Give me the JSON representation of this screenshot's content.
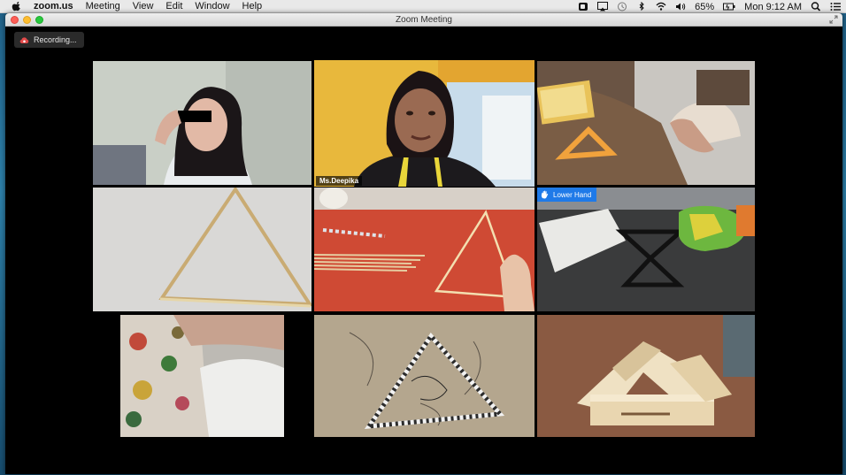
{
  "menubar": {
    "app_name": "zoom.us",
    "menus": [
      "Meeting",
      "View",
      "Edit",
      "Window",
      "Help"
    ],
    "battery": "65%",
    "clock": "Mon 9:12 AM"
  },
  "window": {
    "title": "Zoom Meeting",
    "recording_label": "Recording..."
  },
  "tiles": {
    "active_speaker_name": "Ms.Deepika",
    "raise_hand_button_label": "Lower Hand"
  },
  "colors": {
    "active_speaker_border": "#d7e84a",
    "lower_hand_badge": "#1f7ae8",
    "recording_dot": "#e24a4a"
  }
}
